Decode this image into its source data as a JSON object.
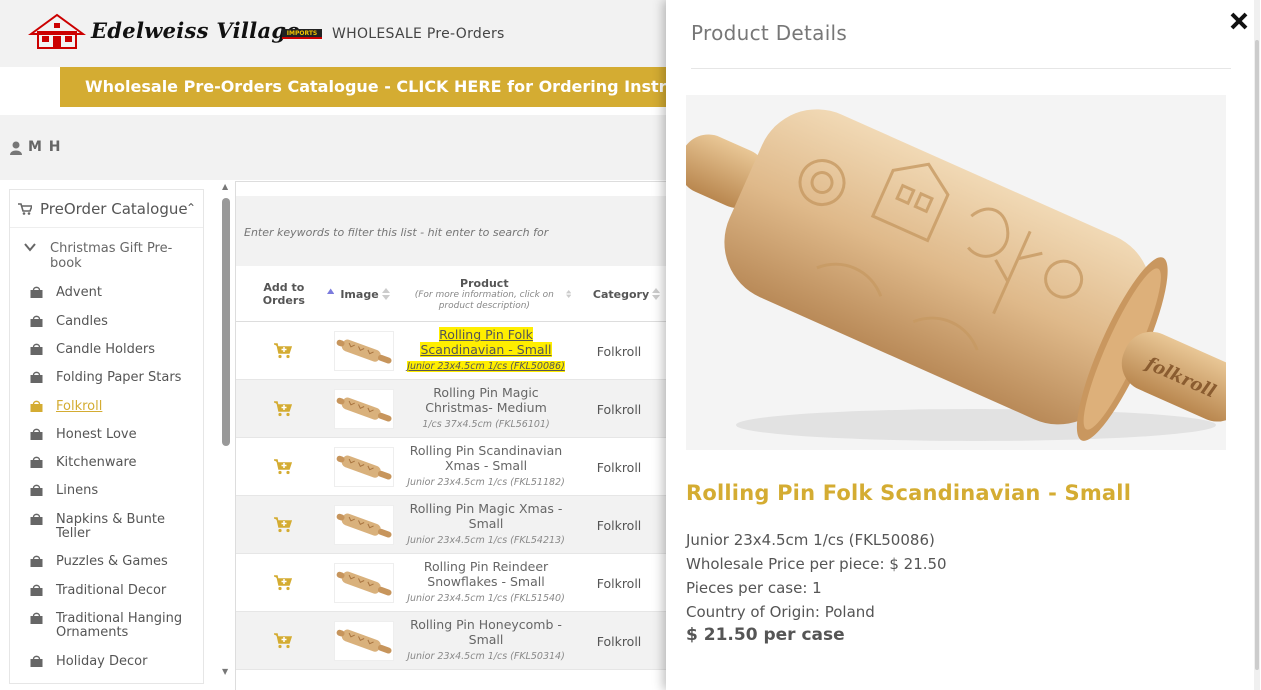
{
  "header": {
    "logo_text": "Edelweiss Village",
    "logo_badge": "IMPORTS",
    "section": "WHOLESALE  Pre-Orders"
  },
  "banner": {
    "text": "Wholesale Pre-Orders Catalogue - CLICK HERE for Ordering Instructions"
  },
  "user": {
    "name": "M H",
    "icon": "user-icon"
  },
  "sidebar": {
    "title": "PreOrder Catalogue",
    "group": "Christmas Gift Pre-book",
    "items": [
      {
        "label": "Advent"
      },
      {
        "label": "Candles"
      },
      {
        "label": "Candle Holders"
      },
      {
        "label": "Folding Paper Stars"
      },
      {
        "label": "Folkroll",
        "active": true
      },
      {
        "label": "Honest Love"
      },
      {
        "label": "Kitchenware"
      },
      {
        "label": "Linens"
      },
      {
        "label": "Napkins & Bunte Teller"
      },
      {
        "label": "Puzzles & Games"
      },
      {
        "label": "Traditional Decor"
      },
      {
        "label": "Traditional Hanging Ornaments"
      },
      {
        "label": "Holiday Decor"
      }
    ]
  },
  "table": {
    "filter_placeholder": "Enter keywords to filter this list - hit enter to search for",
    "columns": {
      "add": "Add to Orders",
      "image": "Image",
      "product": "Product",
      "product_sub": "(For more information, click on product description)",
      "category": "Category"
    },
    "rows": [
      {
        "name": "Rolling Pin Folk Scandinavian - Small",
        "desc": "Junior 23x4.5cm 1/cs (FKL50086)",
        "category": "Folkroll"
      },
      {
        "name": "Rolling Pin Magic Christmas- Medium",
        "desc": "1/cs 37x4.5cm (FKL56101)",
        "category": "Folkroll"
      },
      {
        "name": "Rolling Pin Scandinavian Xmas - Small",
        "desc": "Junior 23x4.5cm 1/cs (FKL51182)",
        "category": "Folkroll"
      },
      {
        "name": "Rolling Pin Magic Xmas - Small",
        "desc": "Junior 23x4.5cm 1/cs (FKL54213)",
        "category": "Folkroll"
      },
      {
        "name": "Rolling Pin Reindeer Snowflakes - Small",
        "desc": "Junior 23x4.5cm 1/cs (FKL51540)",
        "category": "Folkroll"
      },
      {
        "name": "Rolling Pin Honeycomb - Small",
        "desc": "Junior 23x4.5cm 1/cs (FKL50314)",
        "category": "Folkroll"
      }
    ]
  },
  "panel": {
    "title": "Product Details",
    "product_name": "Rolling Pin Folk Scandinavian - Small",
    "line1": "Junior 23x4.5cm 1/cs (FKL50086)",
    "line2": "Wholesale Price per piece: $ 21.50",
    "line3": "Pieces per case: 1",
    "line4": "Country of Origin: Poland",
    "case_price": "$ 21.50 per case",
    "image_brand": "folkroll"
  },
  "colors": {
    "accent": "#d4ac32",
    "highlight": "#ffee00"
  }
}
